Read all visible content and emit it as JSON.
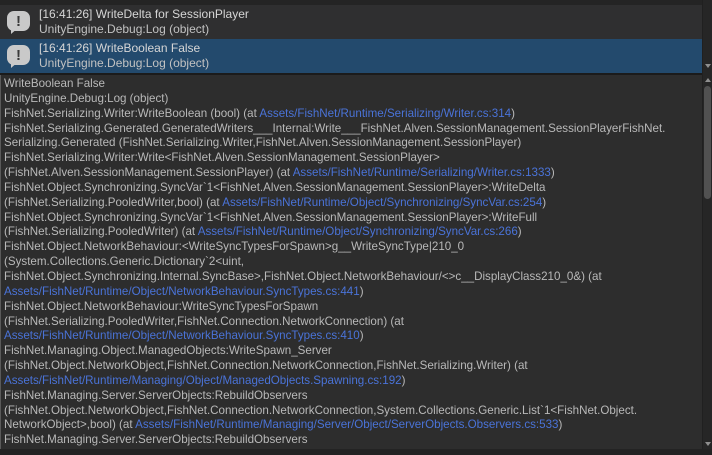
{
  "console": {
    "colors": {
      "selection": "#234a6d",
      "link": "#4a73d8",
      "detail_text": "#b9b9b9",
      "row_bg": "#2f2f30",
      "detail_bg": "#2d2d2d"
    },
    "entries": [
      {
        "message": "[16:41:26] WriteDelta for SessionPlayer",
        "source": "UnityEngine.Debug:Log (object)",
        "selected": false
      },
      {
        "message": "[16:41:26] WriteBoolean False",
        "source": "UnityEngine.Debug:Log (object)",
        "selected": true
      }
    ],
    "detail": {
      "lines": [
        [
          {
            "t": "WriteBoolean False"
          }
        ],
        [
          {
            "t": "UnityEngine.Debug:Log (object)"
          }
        ],
        [
          {
            "t": "FishNet.Serializing.Writer:WriteBoolean (bool) (at "
          },
          {
            "t": "Assets/FishNet/Runtime/Serializing/Writer.cs:314",
            "link": true
          },
          {
            "t": ")"
          }
        ],
        [
          {
            "t": "FishNet.Serializing.Generated.GeneratedWriters___Internal:Write___FishNet.Alven.SessionManagement.SessionPlayerFishNet."
          }
        ],
        [
          {
            "t": "Serializing.Generated (FishNet.Serializing.Writer,FishNet.Alven.SessionManagement.SessionPlayer)"
          }
        ],
        [
          {
            "t": "FishNet.Serializing.Writer:Write<FishNet.Alven.SessionManagement.SessionPlayer>"
          }
        ],
        [
          {
            "t": "(FishNet.Alven.SessionManagement.SessionPlayer) (at "
          },
          {
            "t": "Assets/FishNet/Runtime/Serializing/Writer.cs:1333",
            "link": true
          },
          {
            "t": ")"
          }
        ],
        [
          {
            "t": "FishNet.Object.Synchronizing.SyncVar`1<FishNet.Alven.SessionManagement.SessionPlayer>:WriteDelta"
          }
        ],
        [
          {
            "t": "(FishNet.Serializing.PooledWriter,bool) (at "
          },
          {
            "t": "Assets/FishNet/Runtime/Object/Synchronizing/SyncVar.cs:254",
            "link": true
          },
          {
            "t": ")"
          }
        ],
        [
          {
            "t": "FishNet.Object.Synchronizing.SyncVar`1<FishNet.Alven.SessionManagement.SessionPlayer>:WriteFull"
          }
        ],
        [
          {
            "t": "(FishNet.Serializing.PooledWriter) (at "
          },
          {
            "t": "Assets/FishNet/Runtime/Object/Synchronizing/SyncVar.cs:266",
            "link": true
          },
          {
            "t": ")"
          }
        ],
        [
          {
            "t": "FishNet.Object.NetworkBehaviour:<WriteSyncTypesForSpawn>g__WriteSyncType|210_0"
          }
        ],
        [
          {
            "t": "(System.Collections.Generic.Dictionary`2<uint,"
          }
        ],
        [
          {
            "t": "FishNet.Object.Synchronizing.Internal.SyncBase>,FishNet.Object.NetworkBehaviour/<>c__DisplayClass210_0&) (at"
          }
        ],
        [
          {
            "t": "Assets/FishNet/Runtime/Object/NetworkBehaviour.SyncTypes.cs:441",
            "link": true
          },
          {
            "t": ")"
          }
        ],
        [
          {
            "t": "FishNet.Object.NetworkBehaviour:WriteSyncTypesForSpawn"
          }
        ],
        [
          {
            "t": "(FishNet.Serializing.PooledWriter,FishNet.Connection.NetworkConnection) (at"
          }
        ],
        [
          {
            "t": "Assets/FishNet/Runtime/Object/NetworkBehaviour.SyncTypes.cs:410",
            "link": true
          },
          {
            "t": ")"
          }
        ],
        [
          {
            "t": "FishNet.Managing.Object.ManagedObjects:WriteSpawn_Server"
          }
        ],
        [
          {
            "t": "(FishNet.Object.NetworkObject,FishNet.Connection.NetworkConnection,FishNet.Serializing.Writer) (at"
          }
        ],
        [
          {
            "t": "Assets/FishNet/Runtime/Managing/Object/ManagedObjects.Spawning.cs:192",
            "link": true
          },
          {
            "t": ")"
          }
        ],
        [
          {
            "t": "FishNet.Managing.Server.ServerObjects:RebuildObservers"
          }
        ],
        [
          {
            "t": "(FishNet.Object.NetworkObject,FishNet.Connection.NetworkConnection,System.Collections.Generic.List`1<FishNet.Object."
          }
        ],
        [
          {
            "t": "NetworkObject>,bool) (at "
          },
          {
            "t": "Assets/FishNet/Runtime/Managing/Server/Object/ServerObjects.Observers.cs:533",
            "link": true
          },
          {
            "t": ")"
          }
        ],
        [
          {
            "t": "FishNet.Managing.Server.ServerObjects:RebuildObservers"
          }
        ]
      ]
    },
    "icon": {
      "glyph": "!",
      "name": "log-message-icon"
    }
  }
}
